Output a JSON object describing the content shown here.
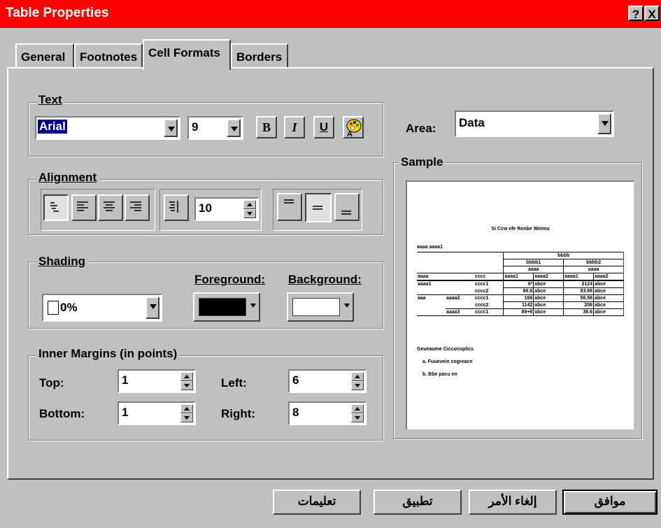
{
  "window": {
    "title": "Table Properties",
    "help_label": "?",
    "close_label": "X"
  },
  "tabs": [
    {
      "label": "General"
    },
    {
      "label": "Footnotes"
    },
    {
      "label": "Cell Formats"
    },
    {
      "label": "Borders"
    }
  ],
  "text_group": {
    "label": "Text",
    "font": "Arial",
    "size": "9",
    "bold_label": "B",
    "italic_label": "I",
    "underline_label": "U",
    "color_icon": "palette-icon"
  },
  "area": {
    "label": "Area:",
    "value": "Data"
  },
  "alignment_group": {
    "label": "Alignment",
    "indent_value": "10"
  },
  "shading_group": {
    "label": "Shading",
    "pattern": "0%",
    "foreground_label": "Foreground:",
    "background_label": "Background:",
    "foreground_color": "#000000",
    "background_color": "#ffffff"
  },
  "margins_group": {
    "label": "Inner Margins (in points)",
    "top_label": "Top:",
    "top_value": "1",
    "bottom_label": "Bottom:",
    "bottom_value": "1",
    "left_label": "Left:",
    "left_value": "6",
    "right_label": "Right:",
    "right_value": "8"
  },
  "sample": {
    "label": "Sample",
    "title": "Si Ccw efe Renbe Weimu",
    "corner": "aaaa aaaa1",
    "header_top": "bbbb",
    "header_mid": [
      "bbbb1",
      "bbbb2"
    ],
    "header_sub": [
      "aaaa",
      "aaaa"
    ],
    "col_heads": [
      "aaaa",
      "cccc",
      "aaaa1",
      "aaaa2",
      "aaaa1",
      "aaaa2"
    ],
    "rows": [
      [
        "aaaa1",
        "",
        "cccc1",
        "6ª",
        "abce",
        "2124",
        "abce"
      ],
      [
        "",
        "",
        "cccc2",
        "66.6",
        "abce",
        "83.66",
        "abce"
      ],
      [
        "aaa",
        "aaaa2",
        "cccc1",
        "166",
        "abce",
        "56.56",
        "abce"
      ],
      [
        "",
        "",
        "cccc2",
        "1142",
        "abce",
        "206",
        "abce"
      ],
      [
        "",
        "aaaa3",
        "cccc1",
        "89+6",
        "abce",
        "36.6",
        "abce"
      ]
    ],
    "notes": [
      "Geueaume Ciccunsplics",
      "a. Fuuevein cogreacn",
      "b. Bbe pacu en"
    ]
  },
  "buttons": {
    "ok": "موافق",
    "cancel": "إلغاء الأمر",
    "apply": "تطبيق",
    "help": "تعليمات"
  }
}
